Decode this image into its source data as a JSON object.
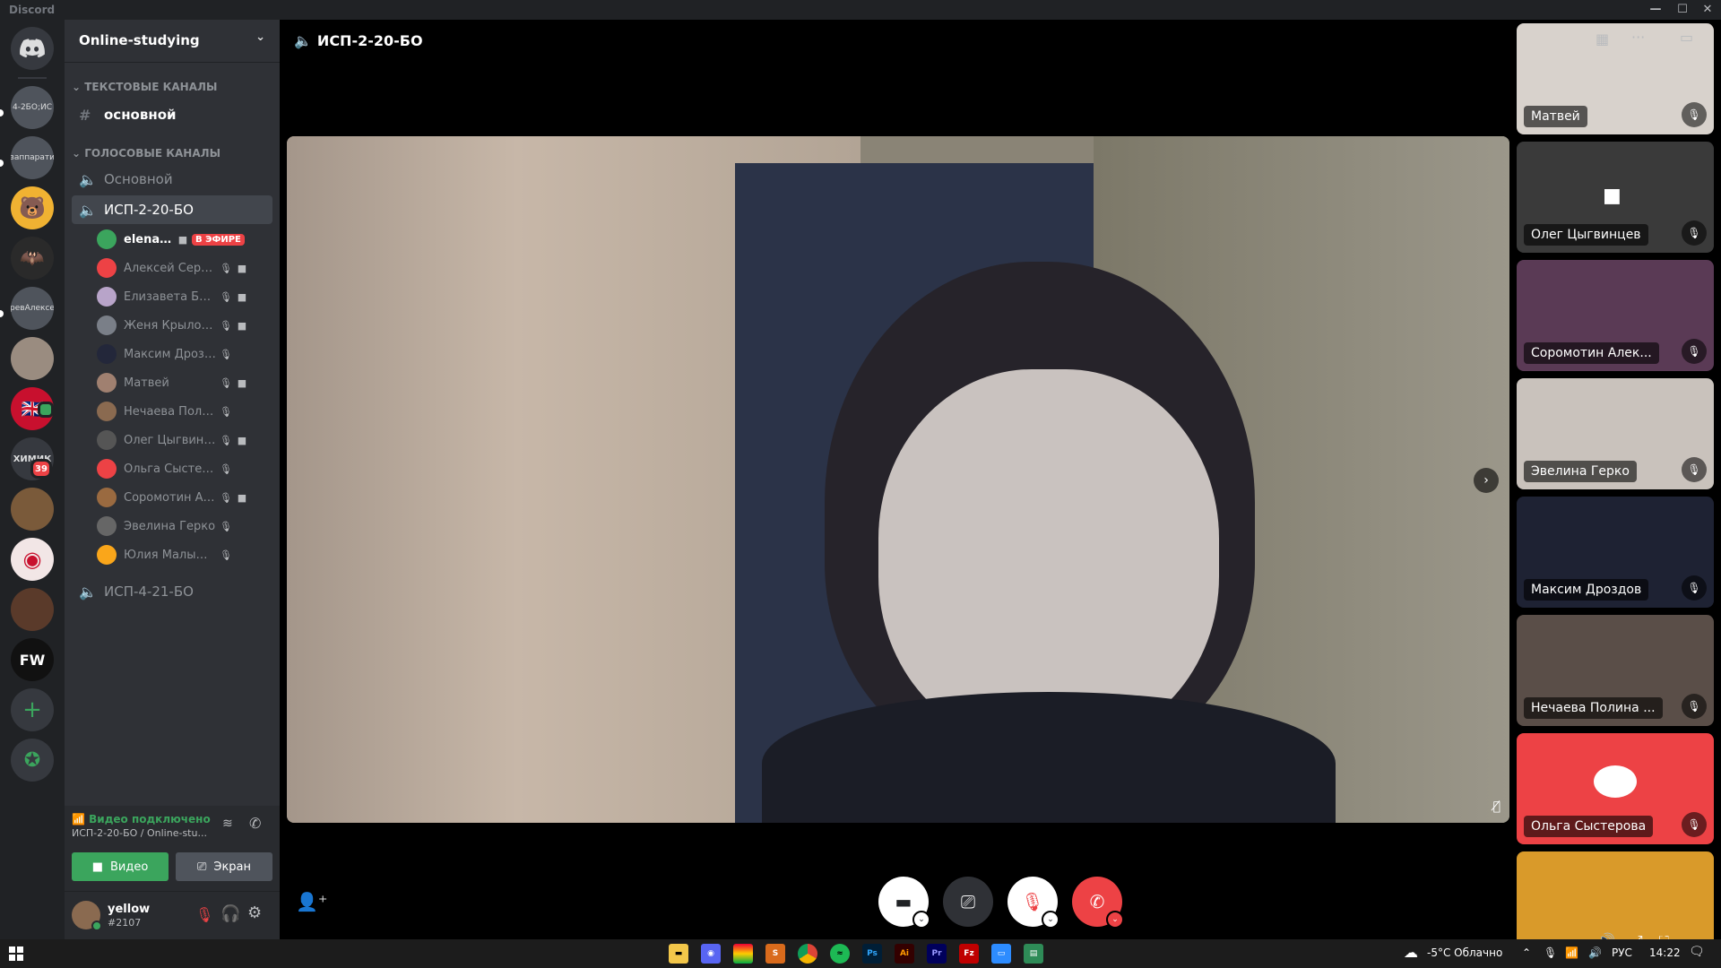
{
  "app": {
    "title": "Discord"
  },
  "server": {
    "name": "Online-studying"
  },
  "categories": {
    "text": "ТЕКСТОВЫЕ КАНАЛЫ",
    "voice": "ГОЛОСОВЫЕ КАНАЛЫ"
  },
  "text_channels": [
    {
      "name": "основной"
    }
  ],
  "voice_channels": [
    {
      "name": "Основной"
    },
    {
      "name": "ИСП-2-20-БО"
    },
    {
      "name": "ИСП-4-21-БО"
    }
  ],
  "voice_users": [
    {
      "name": "elenas...",
      "live_label": "В ЭФИРЕ",
      "color": "#3ba55d"
    },
    {
      "name": "Алексей Серге...",
      "color": "#ed4245"
    },
    {
      "name": "Елизавета Богд...",
      "color": "#b8a4c9"
    },
    {
      "name": "Женя Крылов ...",
      "color": "#7a7f88"
    },
    {
      "name": "Максим Дроздов",
      "color": "#23273a"
    },
    {
      "name": "Матвей",
      "color": "#a08070"
    },
    {
      "name": "Нечаева Полина И...",
      "color": "#8a6a50"
    },
    {
      "name": "Олег Цыгвинцев",
      "color": "#555"
    },
    {
      "name": "Ольга Сыстерова",
      "color": "#ed4245"
    },
    {
      "name": "Соромотин Але...",
      "color": "#9a6a40"
    },
    {
      "name": "Эвелина Герко",
      "color": "#666"
    },
    {
      "name": "Юлия Малышева",
      "color": "#faa61a"
    }
  ],
  "guilds": [
    {
      "label": "4-2БО;ИС"
    },
    {
      "label": "заппарати"
    },
    {
      "label": "ревАлексе"
    },
    {
      "label": "ХИМИК",
      "badge": "39"
    },
    {
      "label": "FW"
    }
  ],
  "voice_panel": {
    "status": "Видео подключено",
    "channel": "ИСП-2-20-БО / Online-stu...",
    "video_label": "Видео",
    "screen_label": "Экран"
  },
  "user": {
    "name": "yellow",
    "tag": "#2107"
  },
  "call": {
    "channel_title": "ИСП-2-20-БО"
  },
  "tiles": [
    {
      "name": "Матвей",
      "color": "#d8d2cc"
    },
    {
      "name": "Олег Цыгвинцев",
      "color": "#3a3a3a"
    },
    {
      "name": "Соромотин Алек...",
      "color": "#5a3a55"
    },
    {
      "name": "Эвелина Герко",
      "color": "#c9c2bc"
    },
    {
      "name": "Максим Дроздов",
      "color": "#1e2233"
    },
    {
      "name": "Нечаева Полина ...",
      "color": "#5a4e48"
    },
    {
      "name": "Ольга Сыстерова",
      "color": "#ed4245"
    },
    {
      "name": "",
      "color": "#d99a2a"
    }
  ],
  "taskbar": {
    "weather": "-5°C Облачно",
    "lang": "РУС",
    "time": "14:22"
  }
}
